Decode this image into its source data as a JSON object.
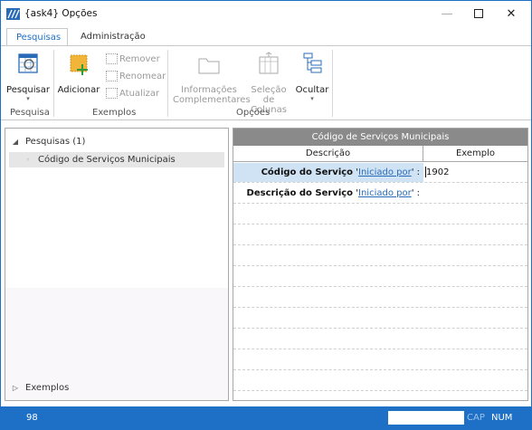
{
  "window": {
    "title": "{ask4}  Opções",
    "controls": {
      "minimize": "—",
      "maximize": "",
      "close": "✕"
    }
  },
  "ribbon": {
    "tabs": [
      {
        "label": "Pesquisas",
        "active": true
      },
      {
        "label": "Administração",
        "active": false
      }
    ],
    "groups": {
      "pesquisa": {
        "label": "Pesquisa",
        "pesquisar": "Pesquisar"
      },
      "exemplos": {
        "label": "Exemplos",
        "adicionar": "Adicionar",
        "remover": "Remover",
        "renomear": "Renomear",
        "atualizar": "Atualizar"
      },
      "opcoes": {
        "label": "Opções",
        "informacoes_l1": "Informações",
        "informacoes_l2": "Complementares",
        "selecao_l1": "Seleção de",
        "selecao_l2": "Colunas",
        "ocultar": "Ocultar"
      }
    },
    "accent_color": "#1e6fc6"
  },
  "tree": {
    "root": {
      "label": "Pesquisas (1)",
      "expanded": true
    },
    "items": [
      {
        "label": "Código de Serviços Municipais",
        "selected": true
      }
    ],
    "footer": {
      "label": "Exemplos",
      "expanded": false
    }
  },
  "grid": {
    "title": "Código de Serviços Municipais",
    "columns": [
      "Descrição",
      "Exemplo"
    ],
    "rows": [
      {
        "label": "Código do Serviço",
        "quote_open": " '",
        "link": "Iniciado por",
        "quote_close": "' :",
        "example": "1902"
      },
      {
        "label": "Descrição do Serviço",
        "quote_open": " '",
        "link": "Iniciado por",
        "quote_close": "' :",
        "example": ""
      }
    ]
  },
  "status": {
    "count": "98",
    "cap": "CAP",
    "num": "NUM"
  }
}
